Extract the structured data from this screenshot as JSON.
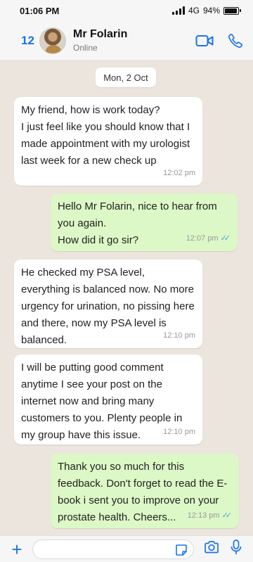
{
  "status_bar": {
    "time": "01:06 PM",
    "network": "4G",
    "battery_pct": "94%",
    "battery_level": 0.94
  },
  "header": {
    "back_count": "12",
    "contact_name": "Mr Folarin",
    "contact_status": "Online",
    "icons": [
      "video-call-icon",
      "voice-call-icon"
    ]
  },
  "chat": {
    "date_label": "Mon, 2 Oct",
    "messages": [
      {
        "direction": "in",
        "text": "My friend, how is work today?\nI just feel like you should know that I made appointment with my urologist last week for a new check up",
        "time": "12:02 pm"
      },
      {
        "direction": "out",
        "text": "Hello Mr Folarin, nice to hear from you again.\nHow did it go sir?",
        "time": "12:07 pm",
        "read": true
      },
      {
        "direction": "in",
        "text": "He checked my PSA level, everything is balanced now. No more urgency for urination, no pissing here and there, now my PSA level is balanced.",
        "time": "12:10 pm"
      },
      {
        "direction": "in",
        "text": "I will be putting good comment anytime I see your post on the internet now and bring many customers to you. Plenty people in my group have this issue.",
        "time": "12:10 pm"
      },
      {
        "direction": "out",
        "text": "Thank you so much for this feedback. Don't forget to read the E-book i sent you to improve on your prostate health. Cheers...",
        "time": "12:13 pm",
        "read": true
      }
    ]
  },
  "input_bar": {
    "message_value": "",
    "icons": [
      "plus-icon",
      "sticker-icon",
      "camera-icon",
      "microphone-icon"
    ]
  },
  "colors": {
    "accent": "#1a73e8",
    "outgoing_bubble": "#dcf8c6",
    "incoming_bubble": "#ffffff",
    "chat_background": "#ece5dd",
    "read_ticks": "#4fa3e3"
  }
}
